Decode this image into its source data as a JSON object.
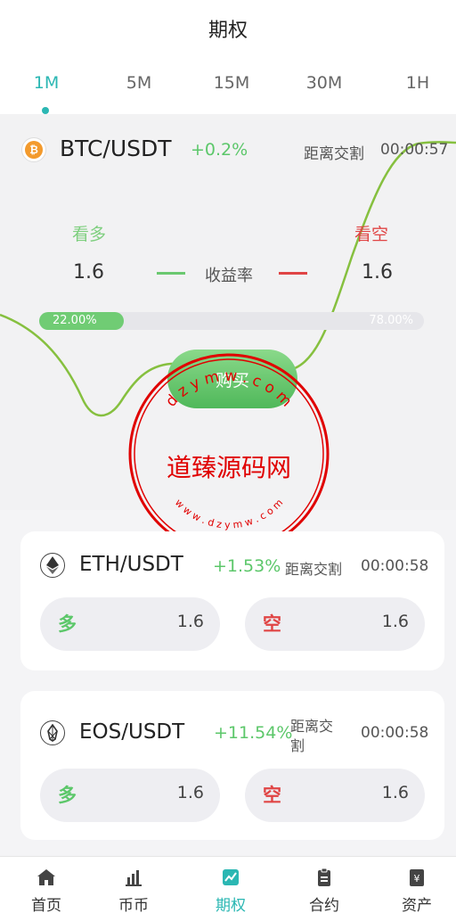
{
  "header": {
    "title": "期权"
  },
  "tabs": [
    {
      "label": "1M",
      "active": true
    },
    {
      "label": "5M",
      "active": false
    },
    {
      "label": "15M",
      "active": false
    },
    {
      "label": "30M",
      "active": false
    },
    {
      "label": "1H",
      "active": false
    }
  ],
  "hero": {
    "pair": "BTC/USDT",
    "coin_glyph": "₿",
    "change": "+0.2%",
    "countdown_label": "距离交割",
    "countdown": "00:00:57",
    "long_label": "看多",
    "short_label": "看空",
    "long_value": "1.6",
    "short_value": "1.6",
    "rate_label": "收益率",
    "long_percent_label": "22.00%",
    "short_percent_label": "78.00%",
    "long_fraction": 0.22,
    "buy_label": "购买"
  },
  "watermark": {
    "top_text": "d z y m w . c o m",
    "center_text": "道臻源码网",
    "bottom_text": "w w w . d z y m w . c o m"
  },
  "cards": [
    {
      "pair": "ETH/USDT",
      "change": "+1.53%",
      "countdown_label": "距离交割",
      "countdown": "00:00:58",
      "long_tag": "多",
      "long_value": "1.6",
      "short_tag": "空",
      "short_value": "1.6"
    },
    {
      "pair": "EOS/USDT",
      "change": "+11.54%",
      "countdown_label_line1": "距离交",
      "countdown_label_line2": "割",
      "countdown": "00:00:58",
      "long_tag": "多",
      "long_value": "1.6",
      "short_tag": "空",
      "short_value": "1.6"
    }
  ],
  "bottom_nav": [
    {
      "label": "首页",
      "icon": "home-icon"
    },
    {
      "label": "币币",
      "icon": "bar-chart-icon"
    },
    {
      "label": "期权",
      "icon": "options-chart-icon",
      "active": true
    },
    {
      "label": "合约",
      "icon": "clipboard-icon"
    },
    {
      "label": "资产",
      "icon": "wallet-icon"
    }
  ],
  "colors": {
    "accent": "#2bb7b3",
    "up": "#5cc76a",
    "down": "#e04545",
    "watermark": "#e00000"
  }
}
